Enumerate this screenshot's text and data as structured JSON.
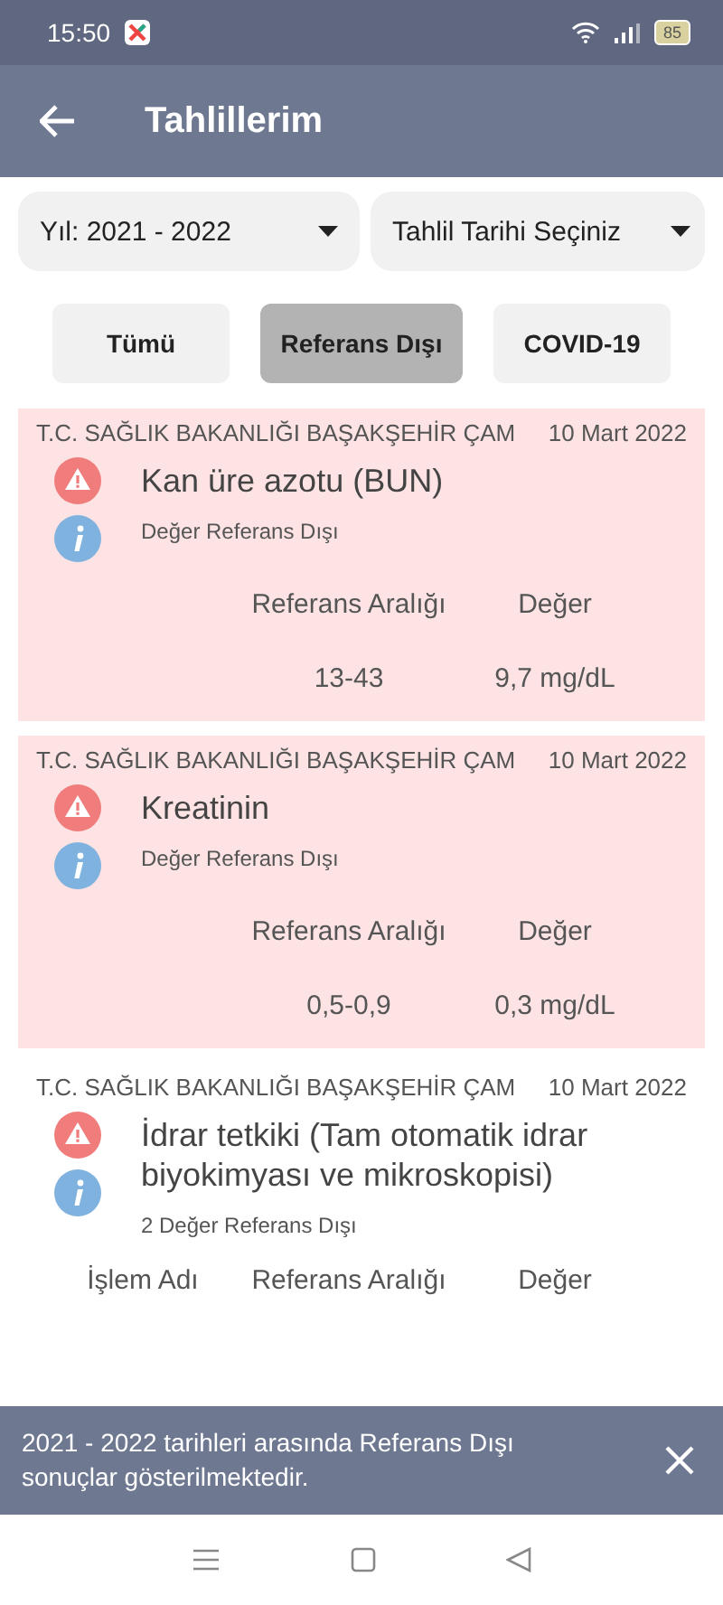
{
  "status_bar": {
    "time": "15:50",
    "battery": "85"
  },
  "app_bar": {
    "title": "Tahlillerim"
  },
  "filters": [
    {
      "label": "Yıl: 2021 - 2022"
    },
    {
      "label": "Tahlil Tarihi Seçiniz"
    }
  ],
  "tabs": [
    {
      "label": "Tümü",
      "selected": false
    },
    {
      "label": "Referans Dışı",
      "selected": true
    },
    {
      "label": "COVID-19",
      "selected": false
    }
  ],
  "results": [
    {
      "institution": "T.C. SAĞLIK BAKANLIĞI BAŞAKŞEHİR ÇAM",
      "date": "10 Mart 2022",
      "test": "Kan üre azotu (BUN)",
      "note": "Değer Referans Dışı",
      "highlighted": true,
      "headers": {
        "reference": "Referans Aralığı",
        "value": "Değer"
      },
      "row": {
        "reference": "13-43",
        "value": "9,7 mg/dL"
      }
    },
    {
      "institution": "T.C. SAĞLIK BAKANLIĞI BAŞAKŞEHİR ÇAM",
      "date": "10 Mart 2022",
      "test": "Kreatinin",
      "note": "Değer Referans Dışı",
      "highlighted": true,
      "headers": {
        "reference": "Referans Aralığı",
        "value": "Değer"
      },
      "row": {
        "reference": "0,5-0,9",
        "value": "0,3 mg/dL"
      }
    },
    {
      "institution": "T.C. SAĞLIK BAKANLIĞI BAŞAKŞEHİR ÇAM",
      "date": "10 Mart 2022",
      "test": "İdrar tetkiki (Tam otomatik idrar biyokimyası ve mikroskopisi)",
      "note": "2 Değer Referans Dışı",
      "highlighted": false,
      "headers": {
        "name": "İşlem Adı",
        "reference": "Referans Aralığı",
        "value": "Değer"
      }
    }
  ],
  "snackbar": {
    "message": "2021 - 2022 tarihleri arasında Referans Dışı sonuçlar gösterilmektedir."
  }
}
